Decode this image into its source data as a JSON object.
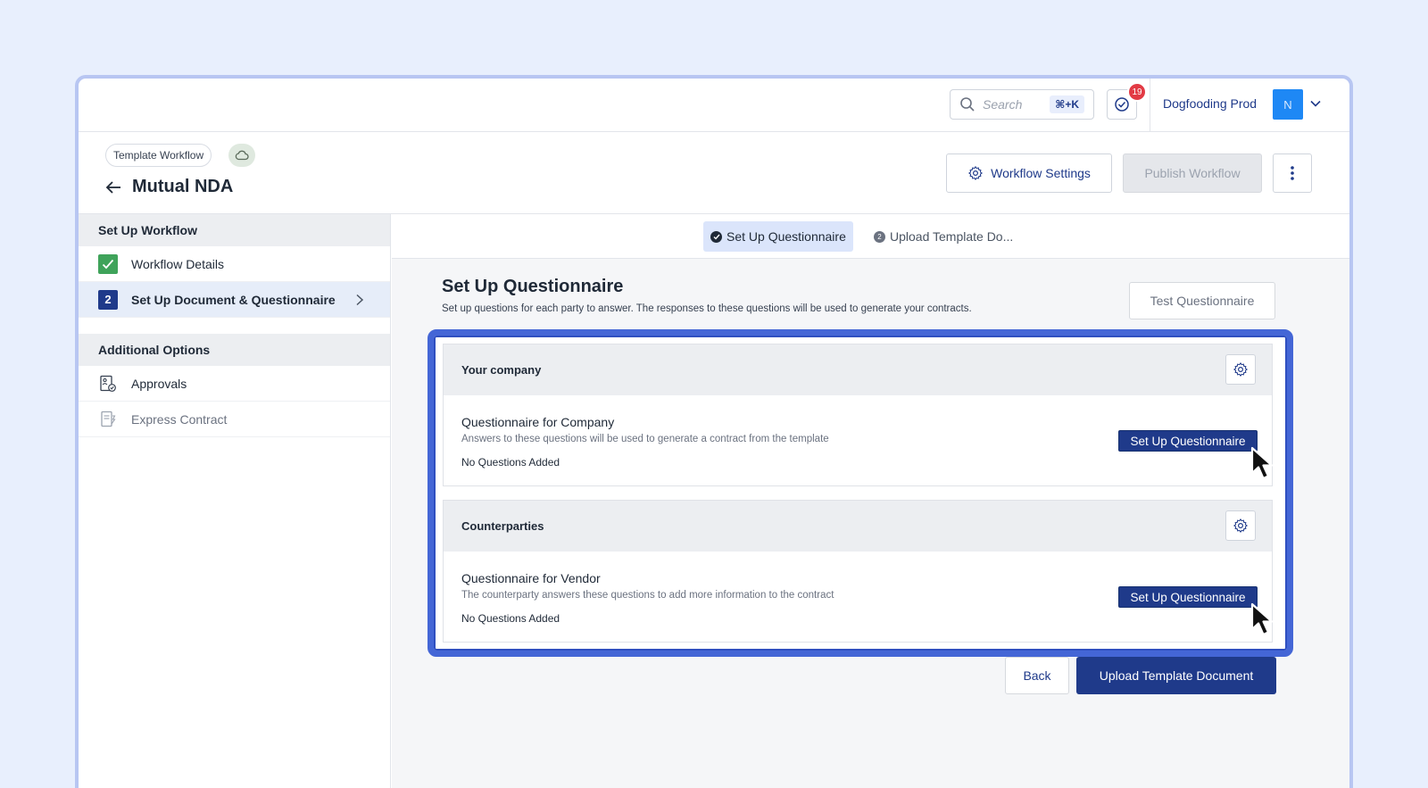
{
  "topbar": {
    "search_placeholder": "Search",
    "search_shortcut": "⌘+K",
    "tasks_badge": "19",
    "org_name": "Dogfooding Prod",
    "avatar_initial": "N"
  },
  "header": {
    "tag": "Template Workflow",
    "title": "Mutual NDA",
    "settings_label": "Workflow Settings",
    "publish_label": "Publish Workflow"
  },
  "sidebar": {
    "section_setup": "Set Up Workflow",
    "items": [
      {
        "label": "Workflow Details",
        "status": "complete"
      },
      {
        "label": "Set Up Document & Questionnaire",
        "step": "2",
        "active": true
      }
    ],
    "section_additional": "Additional Options",
    "additional_items": [
      {
        "label": "Approvals"
      },
      {
        "label": "Express Contract"
      }
    ]
  },
  "stepper": {
    "steps": [
      {
        "label": "Set Up Questionnaire",
        "state": "done"
      },
      {
        "label": "Upload Template Do...",
        "number": "2",
        "state": "pending"
      }
    ]
  },
  "main": {
    "title": "Set Up Questionnaire",
    "description": "Set up questions for each party to answer. The responses to these questions will be used to generate your contracts.",
    "test_label": "Test Questionnaire",
    "parties": [
      {
        "name": "Your company",
        "q_title": "Questionnaire for Company",
        "q_desc": "Answers to these questions will be used to generate a contract from the template",
        "q_count": "No Questions Added",
        "button": "Set Up Questionnaire"
      },
      {
        "name": "Counterparties",
        "q_title": "Questionnaire for Vendor",
        "q_desc": "The counterparty answers these questions to add more information to the contract",
        "q_count": "No Questions Added",
        "button": "Set Up Questionnaire"
      }
    ],
    "back_label": "Back",
    "upload_label": "Upload Template Document"
  },
  "colors": {
    "primary": "#1f3a8a",
    "highlight": "#4466d6",
    "success": "#3fa35a",
    "badge": "#e23a44",
    "avatar": "#1e88f5",
    "page_bg": "#e8effd"
  },
  "icons": [
    "search-icon",
    "task-check-icon",
    "chevron-down-icon",
    "cloud-icon",
    "back-arrow-icon",
    "gear-icon",
    "kebab-menu-icon",
    "checkmark-icon",
    "chevron-right-icon",
    "approvals-icon",
    "express-contract-icon",
    "cursor-arrow-icon"
  ]
}
